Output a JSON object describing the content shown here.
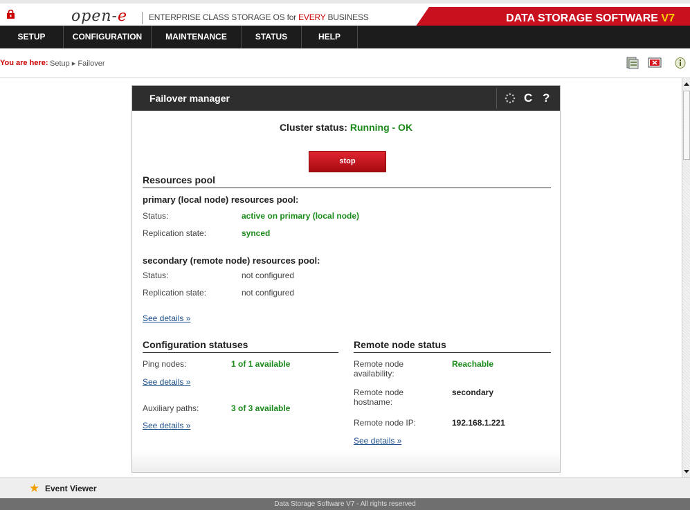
{
  "header": {
    "logo_main": "open-",
    "logo_e": "e",
    "tagline_a": "ENTERPRISE CLASS STORAGE OS for ",
    "tagline_b": "EVERY",
    "tagline_c": " BUSINESS",
    "brand": "DATA STORAGE SOFTWARE ",
    "brand_version": "V7"
  },
  "menu": [
    "SETUP",
    "CONFIGURATION",
    "MAINTENANCE",
    "STATUS",
    "HELP"
  ],
  "breadcrumb": {
    "label": "You are here:",
    "path": "Setup ▸ Failover"
  },
  "panel": {
    "title": "Failover manager",
    "refresh_icon": "C",
    "help_icon": "?",
    "cluster_label": "Cluster status: ",
    "cluster_value": "Running - OK",
    "stop_button": "stop"
  },
  "resources": {
    "title": "Resources pool",
    "primary_title": "primary (local node) resources pool:",
    "primary_status_label": "Status:",
    "primary_status_value": "active on primary (local node)",
    "primary_repl_label": "Replication state:",
    "primary_repl_value": "synced",
    "secondary_title": "secondary (remote node) resources pool:",
    "secondary_status_label": "Status:",
    "secondary_status_value": "not configured",
    "secondary_repl_label": "Replication state:",
    "secondary_repl_value": "not configured",
    "details_link": "See details »"
  },
  "config": {
    "title": "Configuration statuses",
    "ping_label": "Ping nodes:",
    "ping_value": "1 of 1 available",
    "ping_link": "See details »",
    "aux_label": "Auxiliary paths:",
    "aux_value": "3 of 3 available",
    "aux_link": "See details »"
  },
  "remote": {
    "title": "Remote node status",
    "avail_label_1": "Remote node",
    "avail_label_2": "availability:",
    "avail_value": "Reachable",
    "host_label_1": "Remote node",
    "host_label_2": "hostname:",
    "host_value": "secondary",
    "ip_label": "Remote node IP:",
    "ip_value": "192.168.1.221",
    "link": "See details »"
  },
  "bottom": {
    "event_viewer": "Event Viewer",
    "footer": "Data Storage Software V7 - All rights reserved"
  },
  "colors": {
    "accent_red": "#c8101e",
    "status_green": "#1a8a1a",
    "menu_bg": "#1c1c1c"
  }
}
